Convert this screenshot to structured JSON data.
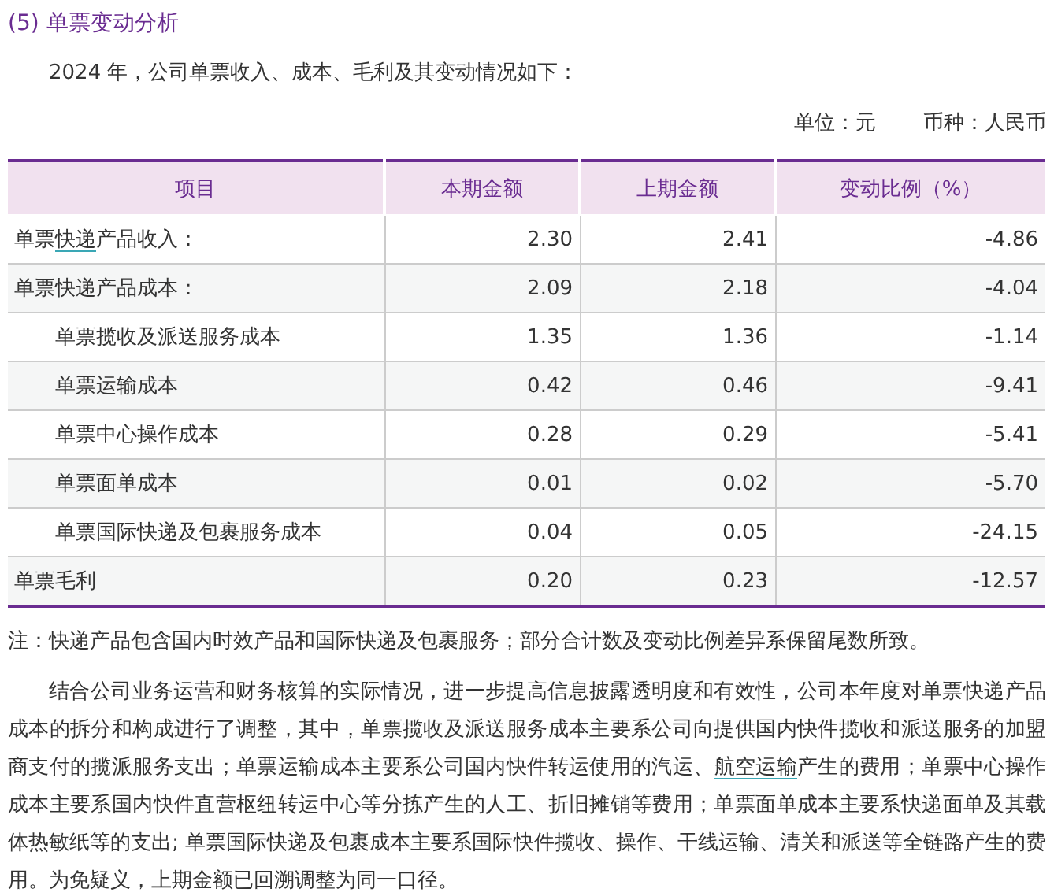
{
  "section_title": "(5) 单票变动分析",
  "intro": "2024 年，公司单票收入、成本、毛利及其变动情况如下：",
  "unit_line": [
    {
      "text": "单位：元"
    },
    {
      "text": "币种：人民币"
    }
  ],
  "table": {
    "columns": [
      "项目",
      "本期金额",
      "上期金额",
      "变动比例（%）"
    ],
    "rows": [
      {
        "item": [
          {
            "kind": "text",
            "text": "单票"
          },
          {
            "kind": "link",
            "text": "快递"
          },
          {
            "kind": "text",
            "text": "产品收入："
          }
        ],
        "current": "2.30",
        "previous": "2.41",
        "change": "-4.86"
      },
      {
        "item": [
          {
            "kind": "text",
            "text": "单票快递产品成本："
          }
        ],
        "current": "2.09",
        "previous": "2.18",
        "change": "-4.04",
        "children": [
          {
            "item": [
              {
                "kind": "text",
                "text": "单票揽收及派送服务成本"
              }
            ],
            "current": "1.35",
            "previous": "1.36",
            "change": "-1.14"
          },
          {
            "item": [
              {
                "kind": "text",
                "text": "单票运输成本"
              }
            ],
            "current": "0.42",
            "previous": "0.46",
            "change": "-9.41"
          },
          {
            "item": [
              {
                "kind": "text",
                "text": "单票中心操作成本"
              }
            ],
            "current": "0.28",
            "previous": "0.29",
            "change": "-5.41"
          },
          {
            "item": [
              {
                "kind": "text",
                "text": "单票面单成本"
              }
            ],
            "current": "0.01",
            "previous": "0.02",
            "change": "-5.70"
          },
          {
            "item": [
              {
                "kind": "text",
                "text": "单票国际快递及包裹服务成本"
              }
            ],
            "current": "0.04",
            "previous": "0.05",
            "change": "-24.15"
          }
        ]
      },
      {
        "item": [
          {
            "kind": "text",
            "text": "单票毛利"
          }
        ],
        "current": "0.20",
        "previous": "0.23",
        "change": "-12.57"
      }
    ]
  },
  "note": "注：快递产品包含国内时效产品和国际快递及包裹服务；部分合计数及变动比例差异系保留尾数所致。",
  "paragraph": [
    {
      "kind": "text",
      "text": "结合公司业务运营和财务核算的实际情况，进一步提高信息披露透明度和有效性，公司本年度对单票快递产品成本的拆分和构成进行了调整，其中，单票揽收及派送服务成本主要系公司向提供国内快件揽收和派送服务的加盟商支付的揽派服务支出；单票运输成本主要系公司国内快件转运使用的汽运、"
    },
    {
      "kind": "link",
      "text": "航空运输"
    },
    {
      "kind": "text",
      "text": "产生的费用；单票中心操作成本主要系国内快件直营枢纽转运中心等分拣产生的人工、折旧摊销等费用；单票面单成本主要系快递面单及其载体热敏纸等的支出; 单票国际快递及包裹成本主要系国际快件揽收、操作、干线运输、清关和派送等全链路产生的费用。为免疑义，上期金额已回溯调整为同一口径。"
    }
  ]
}
